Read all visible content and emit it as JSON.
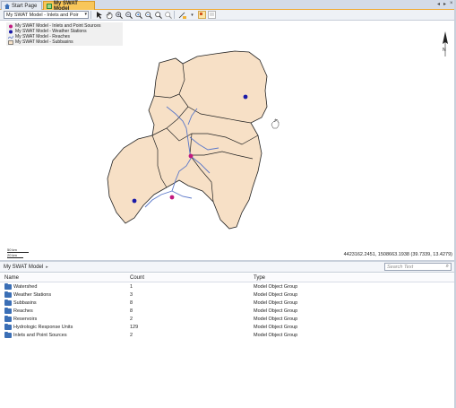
{
  "tabs": [
    {
      "label": "Start Page"
    },
    {
      "label": "My SWAT Model"
    }
  ],
  "toolbar": {
    "layer_selected": "My SWAT Model - Inlets and Poir",
    "tools": [
      "select-arrow-icon",
      "pan-hand-icon",
      "zoom-in-icon",
      "zoom-out-icon",
      "zoom-in-fixed-icon",
      "zoom-out-fixed-icon",
      "full-extent-icon",
      "identify-icon",
      "measure-icon",
      "layer-properties-icon"
    ]
  },
  "legend": {
    "items": [
      {
        "label": "My SWAT Model - Inlets and Point Sources",
        "color": "#c2187f"
      },
      {
        "label": "My SWAT Model - Weather Stations",
        "color": "#1a1aa8"
      },
      {
        "label": "My SWAT Model - Reaches",
        "color": "#5b78c9"
      },
      {
        "label": "My SWAT Model - Subbasins",
        "color": "#f5e1c8"
      }
    ]
  },
  "map": {
    "coords": "4423162.2451, 1508663.1938 (39.7339, 13.4279)",
    "scale_top": "50 km",
    "scale_bottom": "20 km",
    "north_label": "N",
    "subbasin_fill": "#f7e0c6",
    "subbasin_stroke": "#222222",
    "reach_color": "#5b78c9",
    "inlet_color": "#c2187f",
    "station_color": "#1a1aa8"
  },
  "catalog": {
    "breadcrumb": "My SWAT Model",
    "search_placeholder": "Search Text",
    "columns": [
      "Name",
      "Count",
      "Type"
    ],
    "rows": [
      {
        "name": "Watershed",
        "count": "1",
        "type": "Model Object Group"
      },
      {
        "name": "Weather Stations",
        "count": "3",
        "type": "Model Object Group"
      },
      {
        "name": "Subbasins",
        "count": "8",
        "type": "Model Object Group"
      },
      {
        "name": "Reaches",
        "count": "8",
        "type": "Model Object Group"
      },
      {
        "name": "Reservoirs",
        "count": "2",
        "type": "Model Object Group"
      },
      {
        "name": "Hydrologic Response Units",
        "count": "129",
        "type": "Model Object Group"
      },
      {
        "name": "Inlets and Point Sources",
        "count": "2",
        "type": "Model Object Group"
      }
    ]
  }
}
